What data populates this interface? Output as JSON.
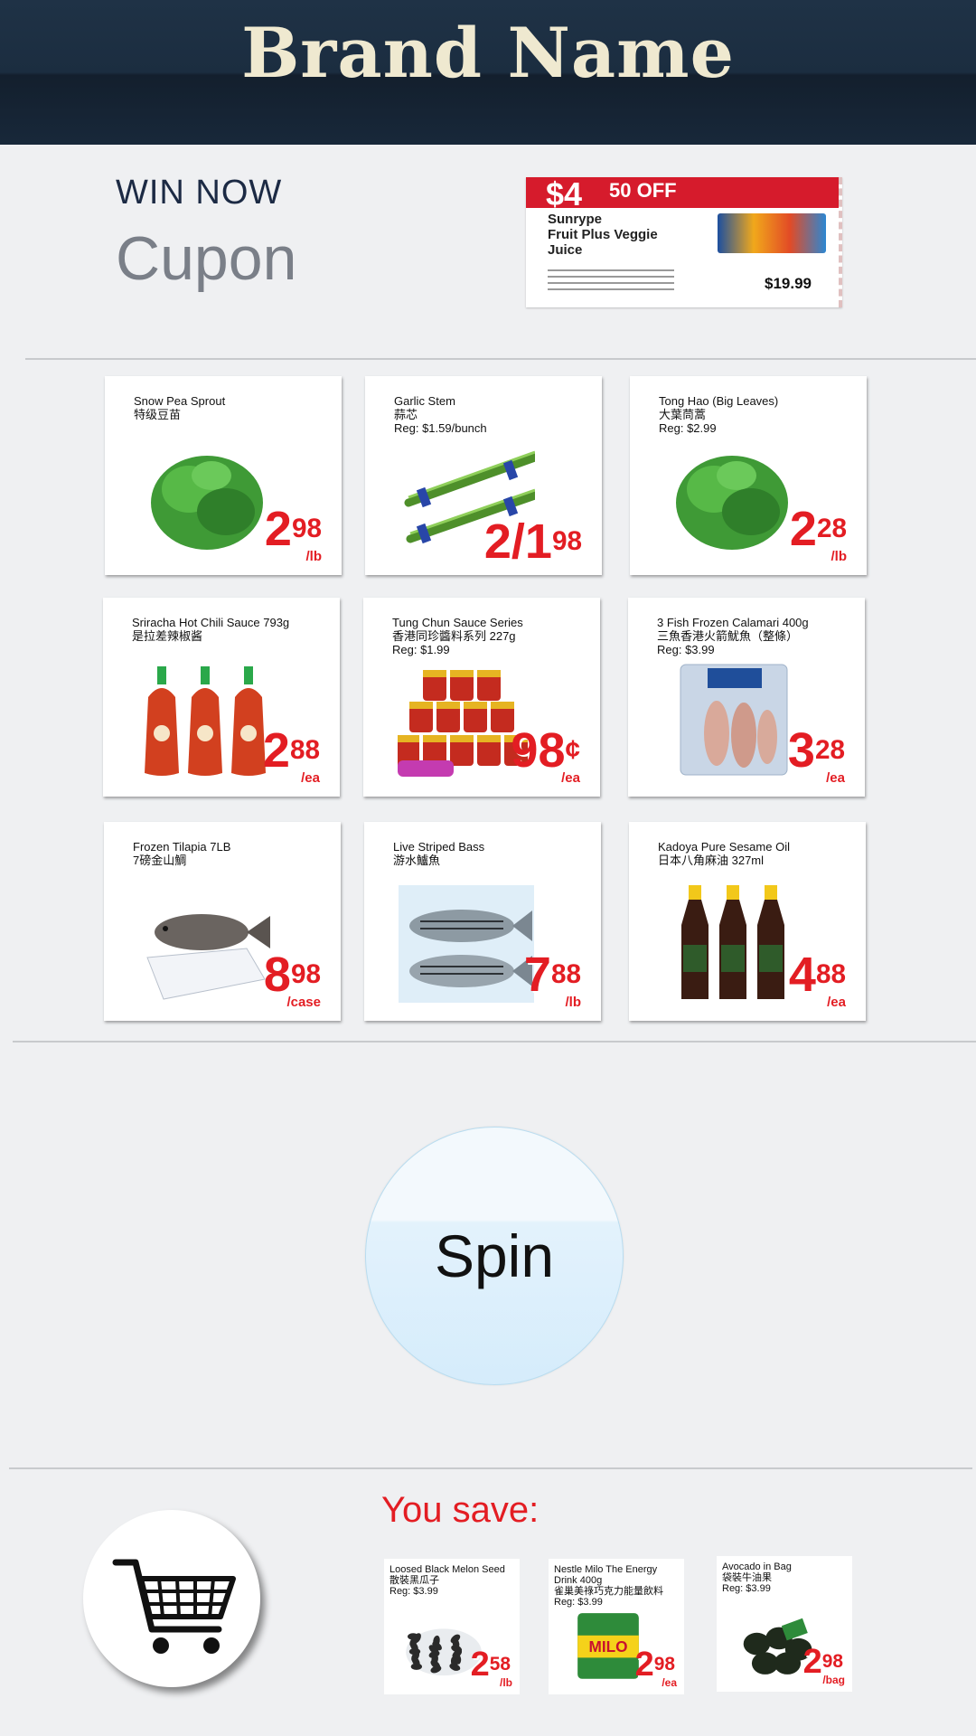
{
  "header": {
    "brand": "Brand Name"
  },
  "promo": {
    "kicker": "WIN NOW",
    "title": "Cupon",
    "coupon": {
      "amount": "$4",
      "off_label": "50 OFF",
      "product": "Sunrype\nFruit Plus Veggie\nJuice",
      "price": "$19.99"
    }
  },
  "products": [
    {
      "name": "Snow Pea Sprout\n特级豆苗",
      "price": "2",
      "cents": "98",
      "unit": "/lb",
      "art": "leafy-green"
    },
    {
      "name": "Garlic Stem\n蒜芯\nReg: $1.59/bunch",
      "price": "2/1",
      "cents": "98",
      "unit": "",
      "art": "garlic-stem"
    },
    {
      "name": "Tong Hao (Big Leaves)\n大葉茼蒿\nReg: $2.99",
      "price": "2",
      "cents": "28",
      "unit": "/lb",
      "art": "leafy-green"
    },
    {
      "name": "Sriracha Hot Chili Sauce 793g\n是拉差辣椒酱",
      "price": "2",
      "cents": "88",
      "unit": "/ea",
      "art": "sauce-bottles"
    },
    {
      "name": "Tung Chun Sauce Series\n香港同珍醬料系列 227g\nReg: $1.99",
      "price": "98",
      "cents": "¢",
      "unit": "/ea",
      "art": "sauce-jars"
    },
    {
      "name": "3 Fish Frozen Calamari 400g\n三魚香港火箭魷魚（整條）\nReg: $3.99",
      "price": "3",
      "cents": "28",
      "unit": "/ea",
      "art": "frozen-bag"
    },
    {
      "name": "Frozen Tilapia 7LB\n7磅金山鯛",
      "price": "8",
      "cents": "98",
      "unit": "/case",
      "art": "fish-box"
    },
    {
      "name": "Live Striped Bass\n游水鱸魚",
      "price": "7",
      "cents": "88",
      "unit": "/lb",
      "art": "fish"
    },
    {
      "name": "Kadoya Pure Sesame Oil\n日本八角麻油 327ml",
      "price": "4",
      "cents": "88",
      "unit": "/ea",
      "art": "oil-bottles"
    }
  ],
  "spin": {
    "label": "Spin"
  },
  "savings": {
    "title": "You save:",
    "items": [
      {
        "name": "Loosed Black Melon Seed\n散裝黑瓜子\nReg: $3.99",
        "price": "2",
        "cents": "58",
        "unit": "/lb",
        "art": "seeds"
      },
      {
        "name": "Nestle Milo The Energy\nDrink 400g\n雀巢美祿巧克力能量飲料\nReg: $3.99",
        "price": "2",
        "cents": "98",
        "unit": "/ea",
        "art": "milo"
      },
      {
        "name": "Avocado in Bag\n袋裝牛油果\nReg: $3.99",
        "price": "2",
        "cents": "98",
        "unit": "/bag",
        "art": "avocado"
      }
    ]
  },
  "colors": {
    "header": "#1b2d40",
    "brand": "#efe9d0",
    "price_red": "#e31d23",
    "background": "#eff0f2"
  },
  "icons": {
    "cart": "shopping-cart-icon"
  }
}
